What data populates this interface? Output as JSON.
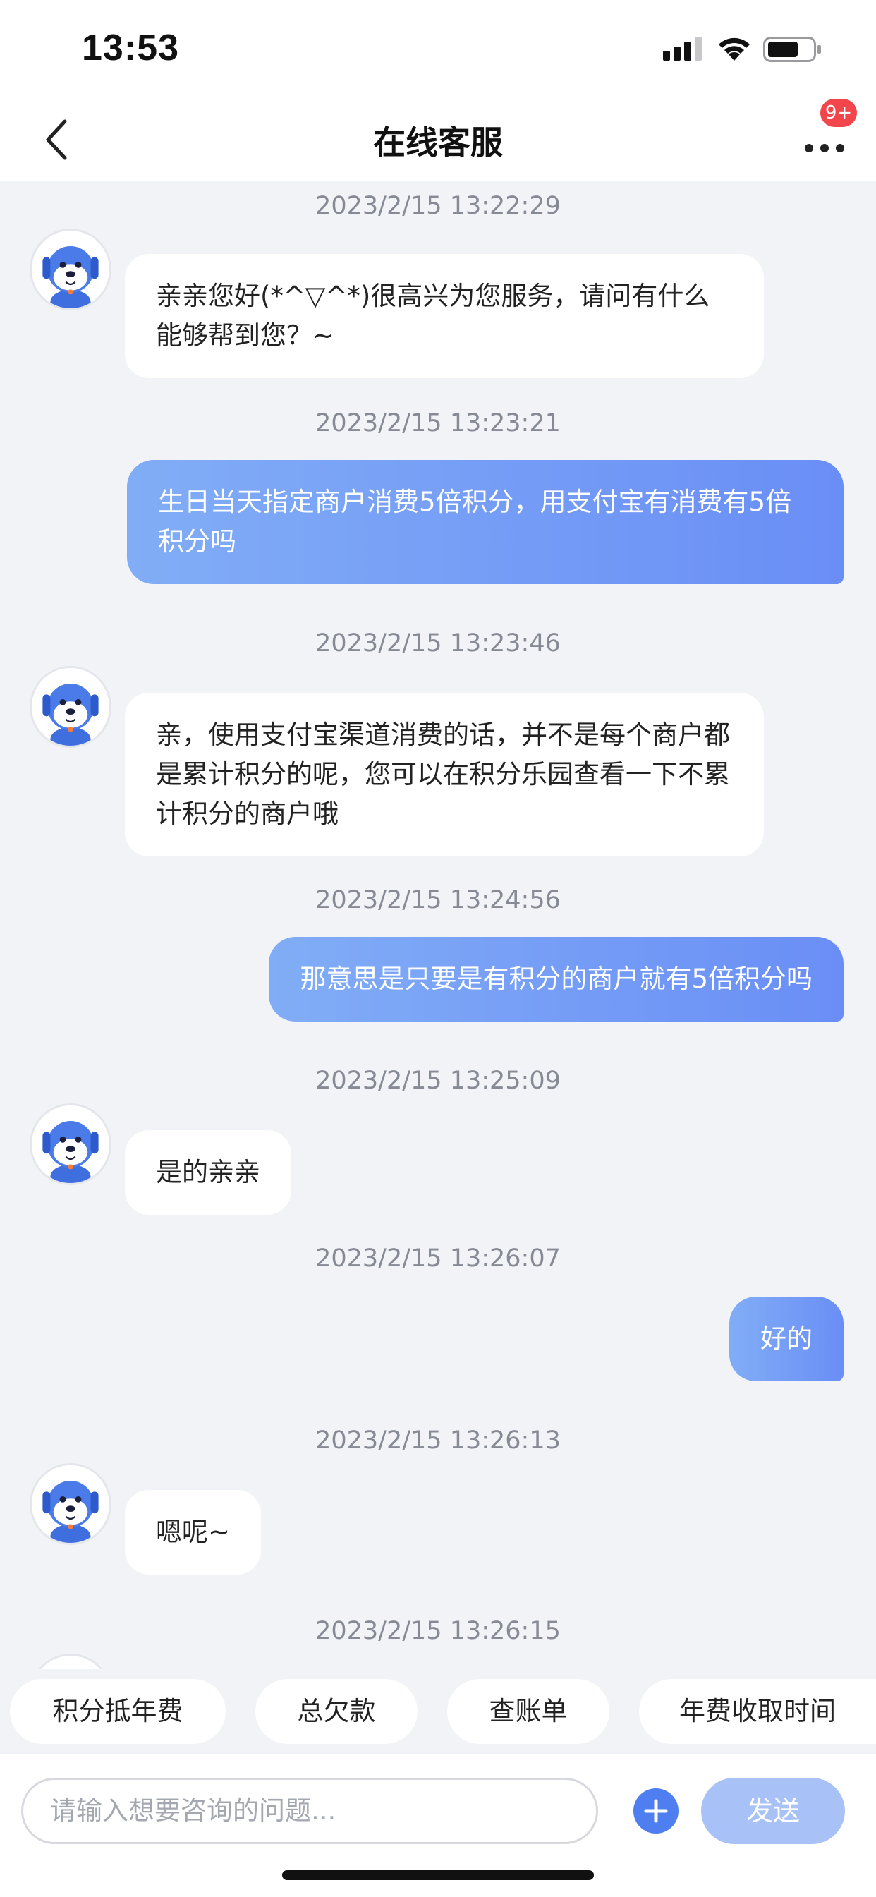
{
  "status_bar": {
    "time": "13:53"
  },
  "nav": {
    "title": "在线客服",
    "badge": "9+"
  },
  "messages": [
    {
      "timestamp": "2023/2/15 13:22:29",
      "from": "agent",
      "text": "亲亲您好(*^▽^*)很高兴为您服务，请问有什么能够帮到您？~"
    },
    {
      "timestamp": "2023/2/15 13:23:21",
      "from": "user",
      "text": "生日当天指定商户消费5倍积分，用支付宝有消费有5倍积分吗"
    },
    {
      "timestamp": "2023/2/15 13:23:46",
      "from": "agent",
      "text": "亲，使用支付宝渠道消费的话，并不是每个商户都是累计积分的呢，您可以在积分乐园查看一下不累计积分的商户哦"
    },
    {
      "timestamp": "2023/2/15 13:24:56",
      "from": "user",
      "text": "那意思是只要是有积分的商户就有5倍积分吗"
    },
    {
      "timestamp": "2023/2/15 13:25:09",
      "from": "agent",
      "text": "是的亲亲"
    },
    {
      "timestamp": "2023/2/15 13:26:07",
      "from": "user",
      "text": "好的"
    },
    {
      "timestamp": "2023/2/15 13:26:13",
      "from": "agent",
      "text": "嗯呢~"
    },
    {
      "timestamp": "2023/2/15 13:26:15",
      "from": "agent",
      "text": ""
    }
  ],
  "quick_replies": [
    "积分抵年费",
    "总欠款",
    "查账单",
    "年费收取时间"
  ],
  "input": {
    "placeholder": "请输入想要咨询的问题...",
    "send_label": "发送"
  },
  "icons": {
    "back": "chevron-left-icon",
    "more": "more-dots-icon",
    "plus": "plus-circle-icon",
    "avatar": "robot-dog-avatar"
  },
  "colors": {
    "user_bubble_start": "#81adf6",
    "user_bubble_end": "#6a8ef6",
    "badge": "#f2454c",
    "send_button": "#a8c2f8",
    "plus_button": "#4f7ef1"
  }
}
